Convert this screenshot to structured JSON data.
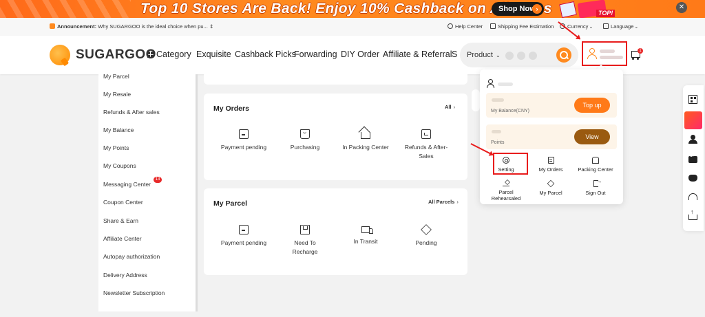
{
  "banner": {
    "headline": "Top 10 Stores Are Back! Enjoy 10% Cashback on All Items",
    "cta": "Shop Now",
    "tag": "TOP!",
    "close_icon": "close-icon"
  },
  "announcement": {
    "label": "Announcement:",
    "text": "Why SUGARGOO is the ideal choice when pu...",
    "marker": "⇕"
  },
  "topnav": {
    "help": "Help Center",
    "shipping": "Shipping Fee Estimation",
    "currency": "Currency",
    "language": "Language"
  },
  "header": {
    "logo": "SUGARGOO",
    "nav": [
      "Category",
      "Exquisite",
      "Cashback Picks",
      "Forwarding",
      "DIY Order",
      "Affiliate & Referral",
      "S"
    ],
    "search_category": "Product",
    "cart_count": "1"
  },
  "sidebar": {
    "items": [
      "My Parcel",
      "My Resale",
      "Refunds & After sales",
      "My Balance",
      "My Points",
      "My Coupons",
      "Messaging Center",
      "Coupon Center",
      "Share & Earn",
      "Affiliate Center",
      "Autopay authorization",
      "Delivery Address",
      "Newsletter Subscription"
    ],
    "messaging_badge": "13"
  },
  "orders": {
    "title": "My Orders",
    "all_link": "All",
    "statuses": [
      "Payment pending",
      "Purchasing",
      "In Packing Center",
      "Refunds & After-Sales"
    ]
  },
  "parcel": {
    "title": "My Parcel",
    "all_link": "All Parcels",
    "statuses": [
      "Payment pending",
      "Need To Recharge",
      "In Transit",
      "Pending"
    ]
  },
  "dropdown": {
    "balance_label": "My Balance(CNY)",
    "topup": "Top up",
    "points_label": "Points",
    "view": "View",
    "menu": [
      "Setting",
      "My Orders",
      "Packing Center",
      "Parcel Rehearsaled",
      "My Parcel",
      "Sign Out"
    ]
  },
  "colors": {
    "brand_orange": "#ff7a18",
    "annotation_red": "#e81c1c",
    "view_brown": "#9a5a10"
  }
}
